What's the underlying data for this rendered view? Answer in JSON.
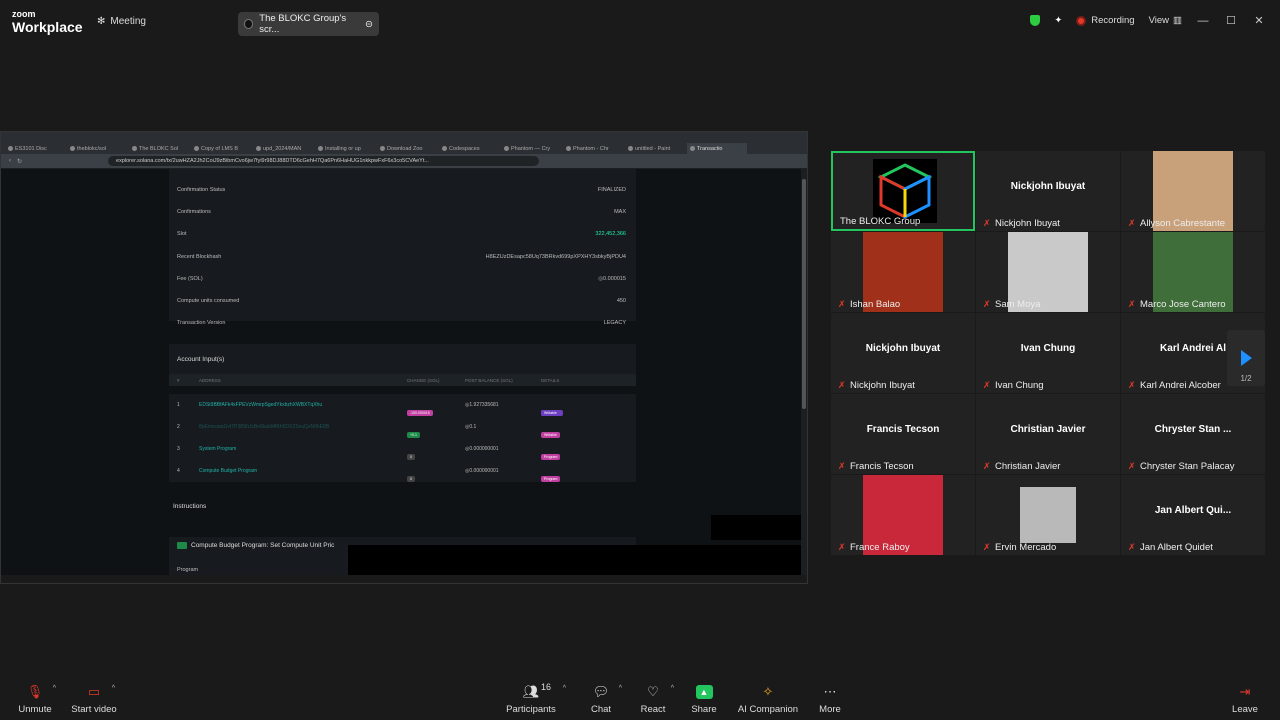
{
  "app": {
    "brand_small": "zoom",
    "brand_big": "Workplace",
    "meeting_label": "Meeting",
    "share_pill_label": "The BLOKC Group's scr...",
    "recording_label": "Recording",
    "view_label": "View"
  },
  "browser": {
    "tabs": [
      "ES3101 Disc",
      "theblokc/sol",
      "The BLOKC Sol",
      "Copy of LMS B",
      "upd_2024/MAN",
      "Installing or up",
      "Download Zoo",
      "Codespaces",
      "Phantom — Cry",
      "Phantom - Chr",
      "untitled - Paint",
      "Transactio"
    ],
    "url": "explorer.solana.com/tx/2uwHZA2Jh2CoiJ9zBibmCvo6jw7fyi9r98DJ88DTD6cGehH7Qa6Pn6HaHUG1nkkpwFxF6x3co5CVAeYt..."
  },
  "explorer": {
    "overview_rows": [
      {
        "label": "Confirmation Status",
        "value": "FINALIZED"
      },
      {
        "label": "Confirmations",
        "value": "MAX"
      },
      {
        "label": "Slot",
        "value": "322,452,366"
      },
      {
        "label": "Recent Blockhash",
        "value": "H8EZUzDEsapc58Uq73BRkvd699pXPXHY3sbkyBjPDU4"
      },
      {
        "label": "Fee (SOL)",
        "value": "◎0.000015"
      },
      {
        "label": "Compute units consumed",
        "value": "450"
      },
      {
        "label": "Transaction Version",
        "value": "LEGACY"
      }
    ],
    "account_inputs_title": "Account Input(s)",
    "table_headers": [
      "#",
      "ADDRESS",
      "CHANGE (SOL)",
      "POST BALANCE (SOL)",
      "DETAILS"
    ],
    "accounts": [
      {
        "idx": "1",
        "address": "EDSt9BBfAFk4xFPEVzWmrpSgedYkxbzhXWBXTqXhu",
        "change": "-100.000015",
        "post": "◎1.927335681",
        "details": [
          "Fee Payer",
          "Signer",
          "Writable"
        ]
      },
      {
        "idx": "2",
        "address": "8pEmscwaGvt7P38ShJcBn6kuhMfKh5DXZSvuQzN9hE8B",
        "change": "+0.1",
        "post": "◎0.1",
        "details": [
          "Writable"
        ]
      },
      {
        "idx": "3",
        "address": "System Program",
        "change": "0",
        "post": "◎0.000000001",
        "details": [
          "Program"
        ]
      },
      {
        "idx": "4",
        "address": "Compute Budget Program",
        "change": "0",
        "post": "◎0.000000001",
        "details": [
          "Program"
        ]
      }
    ],
    "instructions_title": "Instructions",
    "instruction_card_title": "Compute Budget Program: Set Compute Unit Pric",
    "instruction_program_label": "Program"
  },
  "participants": [
    {
      "name": "The BLOKC Group",
      "tile_text": "",
      "muted": false,
      "active": true
    },
    {
      "name": "Nickjohn Ibuyat",
      "tile_text": "Nickjohn Ibuyat",
      "muted": true
    },
    {
      "name": "Allyson Cabrestante",
      "tile_text": "",
      "muted": true
    },
    {
      "name": "Ishan Balao",
      "tile_text": "",
      "muted": true
    },
    {
      "name": "Sam Moya",
      "tile_text": "",
      "muted": true
    },
    {
      "name": "Marco Jose Cantero",
      "tile_text": "",
      "muted": true
    },
    {
      "name": "Nickjohn Ibuyat",
      "tile_text": "Nickjohn Ibuyat",
      "muted": true
    },
    {
      "name": "Ivan Chung",
      "tile_text": "Ivan Chung",
      "muted": true
    },
    {
      "name": "Karl Andrei Alcober",
      "tile_text": "Karl Andrei Al",
      "muted": true
    },
    {
      "name": "Francis Tecson",
      "tile_text": "Francis Tecson",
      "muted": true
    },
    {
      "name": "Christian Javier",
      "tile_text": "Christian Javier",
      "muted": true
    },
    {
      "name": "Chryster Stan Palacay",
      "tile_text": "Chryster Stan ...",
      "muted": true
    },
    {
      "name": "France Raboy",
      "tile_text": "",
      "muted": true
    },
    {
      "name": "Ervin Mercado",
      "tile_text": "",
      "muted": true
    },
    {
      "name": "Jan Albert Quidet",
      "tile_text": "Jan Albert Qui...",
      "muted": true
    }
  ],
  "gallery_page": "1/2",
  "toolbar": {
    "unmute": "Unmute",
    "start_video": "Start video",
    "participants": "Participants",
    "participants_count": "16",
    "chat": "Chat",
    "react": "React",
    "share": "Share",
    "ai_companion": "AI Companion",
    "more": "More",
    "leave": "Leave"
  },
  "colors": {
    "active_speaker": "#22c55e",
    "recording": "#e0392b",
    "share": "#22c55e"
  }
}
